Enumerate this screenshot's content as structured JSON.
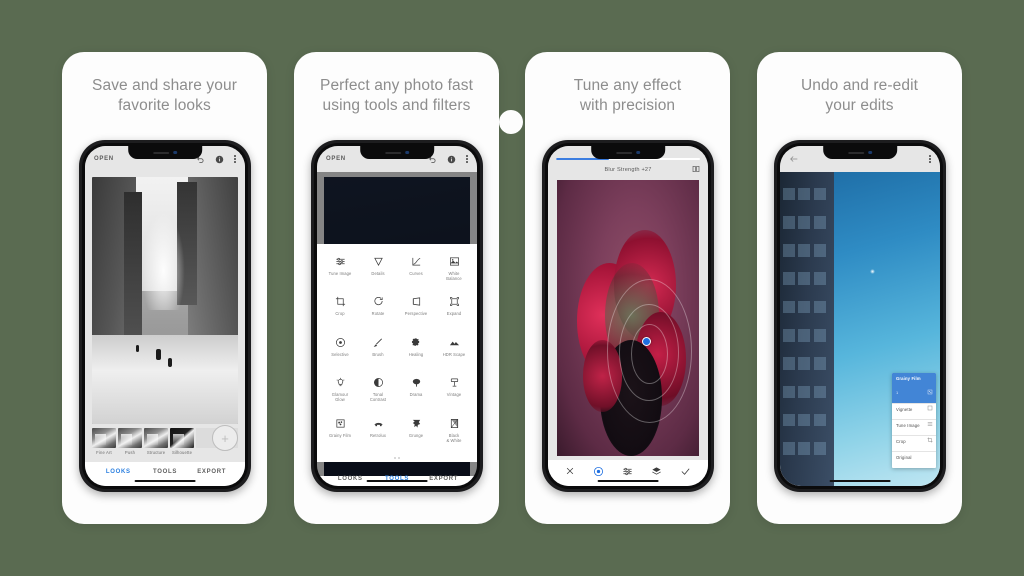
{
  "page": {
    "background_color": "#5a6b51",
    "card_background": "#fdfdfd"
  },
  "cards": [
    {
      "headline": "Save and share your\nfavorite looks",
      "phone": {
        "appbar": {
          "open_label": "OPEN",
          "icons": [
            "undo-icon",
            "info-icon",
            "overflow-menu-icon"
          ]
        },
        "photo_description": "black and white city street with steam",
        "filters": [
          {
            "label": "Fine Art"
          },
          {
            "label": "Push"
          },
          {
            "label": "Structure"
          },
          {
            "label": "Silhouette"
          }
        ],
        "add_button_label": "+",
        "tabs": [
          {
            "label": "LOOKS",
            "active": true
          },
          {
            "label": "TOOLS",
            "active": false
          },
          {
            "label": "EXPORT",
            "active": false
          }
        ],
        "active_tab_color": "#2a7fe0"
      }
    },
    {
      "headline": "Perfect any photo fast\nusing tools and filters",
      "phone": {
        "appbar": {
          "open_label": "OPEN",
          "icons": [
            "undo-icon",
            "info-icon",
            "overflow-menu-icon"
          ]
        },
        "tools": [
          {
            "label": "Tune Image",
            "icon": "sliders-icon"
          },
          {
            "label": "Details",
            "icon": "triangle-down-icon"
          },
          {
            "label": "Curves",
            "icon": "curves-icon"
          },
          {
            "label": "White\nBalance",
            "icon": "white-balance-icon"
          },
          {
            "label": "Crop",
            "icon": "crop-icon"
          },
          {
            "label": "Rotate",
            "icon": "rotate-icon"
          },
          {
            "label": "Perspective",
            "icon": "perspective-icon"
          },
          {
            "label": "Expand",
            "icon": "expand-icon"
          },
          {
            "label": "Selective",
            "icon": "selective-icon"
          },
          {
            "label": "Brush",
            "icon": "brush-icon"
          },
          {
            "label": "Healing",
            "icon": "healing-icon"
          },
          {
            "label": "HDR Scape",
            "icon": "hdr-scape-icon"
          },
          {
            "label": "Glamour\nGlow",
            "icon": "glamour-glow-icon"
          },
          {
            "label": "Tonal\nContrast",
            "icon": "tonal-contrast-icon"
          },
          {
            "label": "Drama",
            "icon": "drama-icon"
          },
          {
            "label": "Vintage",
            "icon": "vintage-icon"
          },
          {
            "label": "Grainy Film",
            "icon": "grainy-film-icon"
          },
          {
            "label": "Retrolux",
            "icon": "retrolux-icon"
          },
          {
            "label": "Grunge",
            "icon": "grunge-icon"
          },
          {
            "label": "Black\n& White",
            "icon": "black-and-white-icon"
          }
        ],
        "tabs": [
          {
            "label": "LOOKS",
            "active": false
          },
          {
            "label": "TOOLS",
            "active": true
          },
          {
            "label": "EXPORT",
            "active": false
          }
        ],
        "active_tab_color": "#2a7fe0"
      }
    },
    {
      "headline": "Tune any effect\nwith precision",
      "phone": {
        "title": "Blur Strength +27",
        "progress_percent": 37,
        "progress_color": "#3b7de0",
        "compare_icon": "compare-icon",
        "photo_description": "red flowers bouquet with selective control point",
        "control_point_color": "#1f6fe0",
        "toolbar": [
          {
            "icon": "close-icon",
            "active": false
          },
          {
            "icon": "control-point-icon",
            "active": true
          },
          {
            "icon": "sliders-icon",
            "active": false
          },
          {
            "icon": "stack-icon",
            "active": false
          },
          {
            "icon": "check-icon",
            "active": false
          }
        ]
      }
    },
    {
      "headline": "Undo and re-edit\nyour edits",
      "phone": {
        "appbar": {
          "back_icon": "back-arrow-icon",
          "menu_icon": "overflow-menu-icon"
        },
        "photo_description": "blue glass building against blue sky",
        "edit_stack": [
          {
            "label": "Grainy Film",
            "count": "1",
            "icon": "grainy-film-icon",
            "active": true
          },
          {
            "label": "Vignette",
            "icon": "vignette-icon",
            "active": false
          },
          {
            "label": "Tune Image",
            "icon": "sliders-icon",
            "active": false
          },
          {
            "label": "Crop",
            "icon": "crop-icon",
            "active": false
          },
          {
            "label": "Original",
            "icon": "",
            "active": false
          }
        ],
        "active_color": "#4285d6"
      }
    }
  ]
}
